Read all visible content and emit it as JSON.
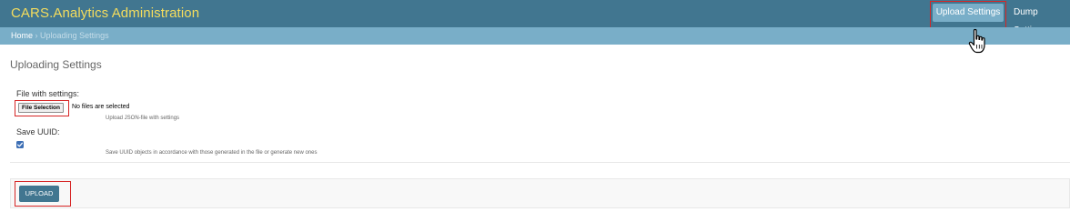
{
  "header": {
    "brand": "CARS.Analytics Administration",
    "nav": {
      "upload_settings": "Upload Settings",
      "dump_settings": "Dump Settings"
    }
  },
  "breadcrumbs": {
    "home": "Home",
    "separator": "›",
    "current": "Uploading Settings"
  },
  "page": {
    "title": "Uploading Settings"
  },
  "form": {
    "file_field": {
      "label": "File with settings:",
      "button": "File Selection",
      "status": "No files are selected",
      "help": "Upload JSON-file with settings"
    },
    "uuid_field": {
      "label": "Save UUID:",
      "checked": true,
      "help": "Save UUID objects in accordance with those generated in the file or generate new ones"
    },
    "submit": "UPLOAD"
  },
  "colors": {
    "header_bg": "#417690",
    "brand_text": "#f5dd5d",
    "breadcrumb_bg": "#79aec8",
    "active_nav_bg": "#79aec8",
    "highlight": "#d62626"
  },
  "icons": {
    "cursor": "hand-pointer-icon",
    "checkbox": "checkbox-checked-icon"
  }
}
